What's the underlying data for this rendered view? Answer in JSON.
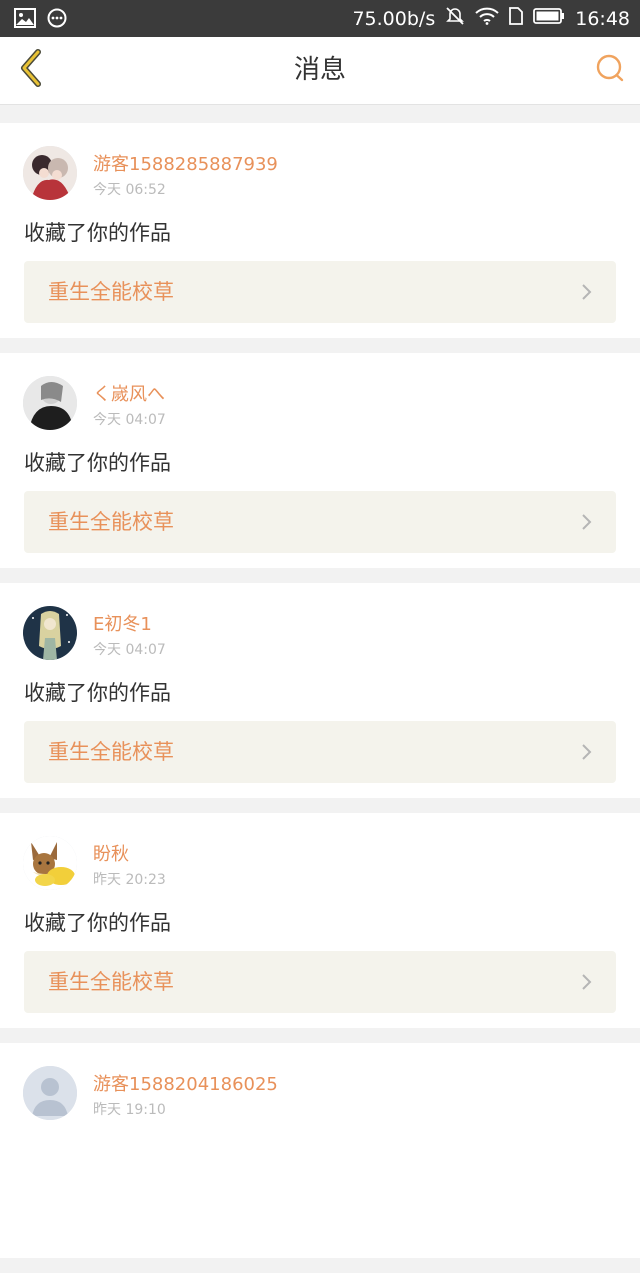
{
  "status_bar": {
    "network_speed": "75.00b/s",
    "time": "16:48",
    "icons": [
      "image-icon",
      "chat-bubble-icon",
      "mute-icon",
      "wifi-icon",
      "sim-icon",
      "battery-icon"
    ]
  },
  "header": {
    "title": "消息",
    "back_icon": "chevron-left-icon",
    "search_icon": "search-icon"
  },
  "colors": {
    "accent": "#e8915a",
    "back_arrow": "#e8c236",
    "card_bg": "#ffffff",
    "link_bg": "#f4f3ec",
    "status_bar": "#3b3b3b"
  },
  "messages": [
    {
      "username": "游客1588285887939",
      "time": "今天 06:52",
      "action": "收藏了你的作品",
      "work_title": "重生全能校草",
      "avatar": "anime-couple"
    },
    {
      "username": "く嵗风へ",
      "time": "今天 04:07",
      "action": "收藏了你的作品",
      "work_title": "重生全能校草",
      "avatar": "dark-figure"
    },
    {
      "username": "E初冬1",
      "time": "今天 04:07",
      "action": "收藏了你的作品",
      "work_title": "重生全能校草",
      "avatar": "night-girl"
    },
    {
      "username": "盼秋",
      "time": "昨天 20:23",
      "action": "收藏了你的作品",
      "work_title": "重生全能校草",
      "avatar": "eevee"
    },
    {
      "username": "游客1588204186025",
      "time": "昨天 19:10",
      "action": "",
      "work_title": "",
      "avatar": "default-user"
    }
  ]
}
